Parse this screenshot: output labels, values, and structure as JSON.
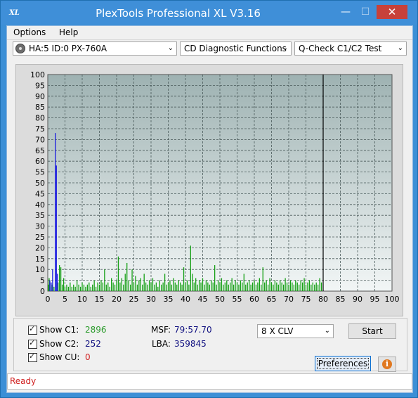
{
  "window": {
    "title": "PlexTools Professional XL V3.16",
    "icon_text": "XL"
  },
  "caption_buttons": {
    "minimize": "—",
    "maximize": "☐",
    "close": "✕"
  },
  "menu": [
    "Options",
    "Help"
  ],
  "toolbar": {
    "drive": "HA:5 ID:0  PX-760A",
    "function": "CD Diagnostic Functions",
    "test": "Q-Check C1/C2 Test",
    "arrow": "⌄"
  },
  "chart_data": {
    "type": "bar",
    "ylim": [
      0,
      100
    ],
    "xlim": [
      0,
      100
    ],
    "y_ticks": [
      0,
      5,
      10,
      15,
      20,
      25,
      30,
      35,
      40,
      45,
      50,
      55,
      60,
      65,
      70,
      75,
      80,
      85,
      90,
      95,
      100
    ],
    "x_ticks": [
      0,
      5,
      10,
      15,
      20,
      25,
      30,
      35,
      40,
      45,
      50,
      55,
      60,
      65,
      70,
      75,
      80,
      85,
      90,
      95,
      100
    ],
    "test_end": 80,
    "grid": true,
    "series": [
      {
        "color": "#1a1ae0",
        "points": [
          [
            2.2,
            73
          ],
          [
            2.5,
            58
          ],
          [
            1.4,
            10
          ],
          [
            0.6,
            5
          ],
          [
            1.0,
            4
          ],
          [
            2.8,
            8
          ]
        ]
      },
      {
        "color": "#16a016",
        "points": [
          [
            0.2,
            3
          ],
          [
            0.4,
            6
          ],
          [
            0.6,
            4
          ],
          [
            1.0,
            2
          ],
          [
            1.3,
            3
          ],
          [
            1.8,
            2
          ],
          [
            3.0,
            4
          ],
          [
            3.4,
            12
          ],
          [
            3.8,
            11
          ],
          [
            4.2,
            3
          ],
          [
            4.6,
            6
          ],
          [
            5.0,
            2
          ],
          [
            5.5,
            3
          ],
          [
            6.0,
            2
          ],
          [
            6.5,
            4
          ],
          [
            7.0,
            2
          ],
          [
            7.5,
            3
          ],
          [
            8.0,
            2
          ],
          [
            8.5,
            5
          ],
          [
            9.0,
            3
          ],
          [
            9.5,
            2
          ],
          [
            10.0,
            4
          ],
          [
            10.5,
            3
          ],
          [
            11.0,
            2
          ],
          [
            11.5,
            3
          ],
          [
            12.0,
            4
          ],
          [
            12.5,
            2
          ],
          [
            13.0,
            3
          ],
          [
            13.5,
            5
          ],
          [
            14.0,
            2
          ],
          [
            14.5,
            4
          ],
          [
            15.0,
            3
          ],
          [
            15.5,
            5
          ],
          [
            16.0,
            4
          ],
          [
            16.5,
            10
          ],
          [
            17.0,
            3
          ],
          [
            17.5,
            4
          ],
          [
            18.0,
            2
          ],
          [
            18.5,
            6
          ],
          [
            19.0,
            4
          ],
          [
            19.5,
            3
          ],
          [
            20.0,
            5
          ],
          [
            20.5,
            16
          ],
          [
            21.0,
            4
          ],
          [
            21.5,
            6
          ],
          [
            22.0,
            3
          ],
          [
            22.5,
            8
          ],
          [
            23.0,
            13
          ],
          [
            23.5,
            5
          ],
          [
            24.0,
            3
          ],
          [
            24.5,
            10
          ],
          [
            25.0,
            4
          ],
          [
            25.5,
            7
          ],
          [
            26.0,
            3
          ],
          [
            26.5,
            5
          ],
          [
            27.0,
            6
          ],
          [
            27.5,
            3
          ],
          [
            28.0,
            8
          ],
          [
            28.5,
            4
          ],
          [
            29.0,
            3
          ],
          [
            29.5,
            5
          ],
          [
            30.0,
            4
          ],
          [
            30.5,
            6
          ],
          [
            31.0,
            3
          ],
          [
            31.5,
            4
          ],
          [
            32.0,
            2
          ],
          [
            32.5,
            5
          ],
          [
            33.0,
            3
          ],
          [
            33.5,
            4
          ],
          [
            34.0,
            8
          ],
          [
            34.5,
            3
          ],
          [
            35.0,
            4
          ],
          [
            35.5,
            5
          ],
          [
            36.0,
            3
          ],
          [
            36.5,
            6
          ],
          [
            37.0,
            4
          ],
          [
            37.5,
            3
          ],
          [
            38.0,
            5
          ],
          [
            38.5,
            4
          ],
          [
            39.0,
            3
          ],
          [
            39.5,
            11
          ],
          [
            40.0,
            4
          ],
          [
            40.5,
            5
          ],
          [
            41.0,
            3
          ],
          [
            41.5,
            21
          ],
          [
            42.0,
            8
          ],
          [
            42.5,
            4
          ],
          [
            43.0,
            6
          ],
          [
            43.5,
            3
          ],
          [
            44.0,
            5
          ],
          [
            44.5,
            4
          ],
          [
            45.0,
            6
          ],
          [
            45.5,
            3
          ],
          [
            46.0,
            5
          ],
          [
            46.5,
            4
          ],
          [
            47.0,
            3
          ],
          [
            47.5,
            5
          ],
          [
            48.0,
            4
          ],
          [
            48.5,
            12
          ],
          [
            49.0,
            3
          ],
          [
            49.5,
            5
          ],
          [
            50.0,
            4
          ],
          [
            50.5,
            6
          ],
          [
            51.0,
            3
          ],
          [
            51.5,
            4
          ],
          [
            52.0,
            5
          ],
          [
            52.5,
            3
          ],
          [
            53.0,
            4
          ],
          [
            53.5,
            6
          ],
          [
            54.0,
            3
          ],
          [
            54.5,
            5
          ],
          [
            55.0,
            4
          ],
          [
            55.5,
            3
          ],
          [
            56.0,
            5
          ],
          [
            56.5,
            4
          ],
          [
            57.0,
            8
          ],
          [
            57.5,
            3
          ],
          [
            58.0,
            4
          ],
          [
            58.5,
            5
          ],
          [
            59.0,
            3
          ],
          [
            59.5,
            4
          ],
          [
            60.0,
            5
          ],
          [
            60.5,
            3
          ],
          [
            61.0,
            4
          ],
          [
            61.5,
            6
          ],
          [
            62.0,
            3
          ],
          [
            62.5,
            11
          ],
          [
            63.0,
            4
          ],
          [
            63.5,
            5
          ],
          [
            64.0,
            3
          ],
          [
            64.5,
            6
          ],
          [
            65.0,
            4
          ],
          [
            65.5,
            3
          ],
          [
            66.0,
            5
          ],
          [
            66.5,
            4
          ],
          [
            67.0,
            3
          ],
          [
            67.5,
            5
          ],
          [
            68.0,
            4
          ],
          [
            68.5,
            3
          ],
          [
            69.0,
            6
          ],
          [
            69.5,
            4
          ],
          [
            70.0,
            3
          ],
          [
            70.5,
            5
          ],
          [
            71.0,
            4
          ],
          [
            71.5,
            3
          ],
          [
            72.0,
            5
          ],
          [
            72.5,
            4
          ],
          [
            73.0,
            3
          ],
          [
            73.5,
            5
          ],
          [
            74.0,
            4
          ],
          [
            74.5,
            6
          ],
          [
            75.0,
            3
          ],
          [
            75.5,
            4
          ],
          [
            76.0,
            5
          ],
          [
            76.5,
            3
          ],
          [
            77.0,
            4
          ],
          [
            77.5,
            3
          ],
          [
            78.0,
            4
          ],
          [
            78.5,
            3
          ],
          [
            79.0,
            6
          ],
          [
            79.5,
            4
          ]
        ]
      }
    ]
  },
  "stats": {
    "c1_label": "Show C1:",
    "c1_value": "2896",
    "c2_label": "Show C2:",
    "c2_value": "252",
    "cu_label": "Show CU:",
    "cu_value": "0"
  },
  "position": {
    "msf_label": "MSF:",
    "msf_value": "79:57.70",
    "lba_label": "LBA:",
    "lba_value": "359845"
  },
  "speed": {
    "value": "8 X CLV"
  },
  "buttons": {
    "start": "Start",
    "preferences": "Preferences",
    "info": "i"
  },
  "status": {
    "text": "Ready"
  },
  "colors": {
    "titlebar": "#3f8fd8",
    "plot_top": "#9eb2b2",
    "plot_bottom": "#f2f6f6",
    "c1": "#16a016",
    "c2": "#1a1ae0"
  }
}
